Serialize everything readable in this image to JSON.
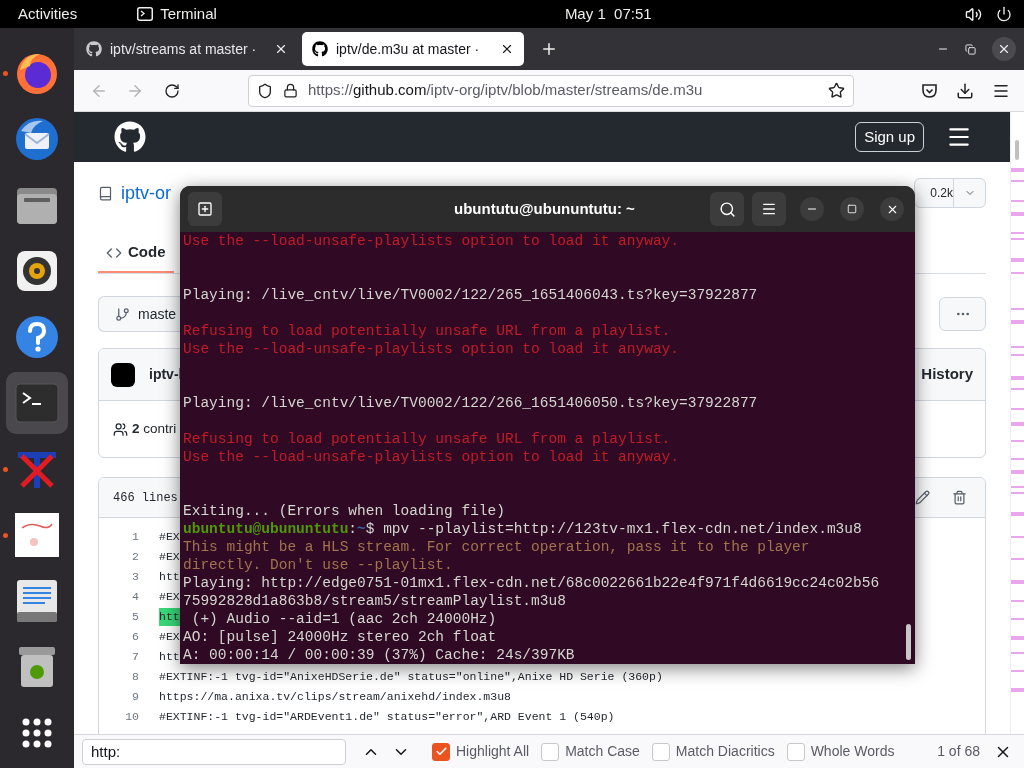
{
  "top_bar": {
    "activities": "Activities",
    "app": "Terminal",
    "clock": "May 1  07:51"
  },
  "dock": [
    {
      "kind": "firefox",
      "running": true,
      "selected": false
    },
    {
      "kind": "thunderbird",
      "running": false,
      "selected": false
    },
    {
      "kind": "files",
      "running": false,
      "selected": false
    },
    {
      "kind": "rhythmbox",
      "running": false,
      "selected": false
    },
    {
      "kind": "help",
      "running": false,
      "selected": false
    },
    {
      "kind": "terminal",
      "running": false,
      "selected": true
    },
    {
      "kind": "tex",
      "running": true,
      "selected": false
    },
    {
      "kind": "image",
      "running": true,
      "selected": false
    },
    {
      "kind": "editor",
      "running": false,
      "selected": false
    },
    {
      "kind": "trash",
      "running": false,
      "selected": false
    },
    {
      "kind": "apps",
      "running": false,
      "selected": false
    }
  ],
  "browser": {
    "tabs": [
      {
        "title": "iptv/streams at master ·",
        "selected": false
      },
      {
        "title": "iptv/de.m3u at master ·",
        "selected": true
      }
    ],
    "url": "https://**github.com**/iptv-org/iptv/blob/master/streams/de.m3u"
  },
  "github": {
    "sign_up": "Sign up",
    "repo": "iptv-or",
    "star_count": "0.2k",
    "tabs": [
      {
        "label": "Code",
        "selected": true
      }
    ],
    "branch": "maste",
    "commit_author": "iptv-l",
    "history": "History",
    "contributors_count": "2",
    "contributors_label": "contri",
    "lines": "466 lines",
    "code_lines": [
      {
        "number": "1",
        "text": "#EX",
        "current_match": false
      },
      {
        "number": "2",
        "text": "#EX",
        "current_match": false
      },
      {
        "number": "3",
        "text": "htt",
        "current_match": false
      },
      {
        "number": "4",
        "text": "#EX",
        "current_match": false
      },
      {
        "number": "5",
        "text": "htt",
        "current_match": true
      },
      {
        "number": "6",
        "text": "#EX",
        "current_match": false
      },
      {
        "number": "7",
        "text": "htt",
        "current_match": false
      },
      {
        "number": "8",
        "text": "#EXTINF:-1 tvg-id=\"AnixeHDSerie.de\" status=\"online\",Anixe HD Serie (360p)",
        "current_match": false
      },
      {
        "number": "9",
        "text": "https://ma.anixa.tv/clips/stream/anixehd/index.m3u8",
        "current_match": false
      },
      {
        "number": "10",
        "text": "#EXTINF:-1 tvg-id=\"ARDEvent1.de\" status=\"error\",ARD Event 1 (540p)",
        "current_match": false
      }
    ]
  },
  "terminal": {
    "title": "ubuntutu@ubununtutu: ~",
    "lines": [
      {
        "kind": "error",
        "text": "Use the --load-unsafe-playlists option to load it anyway."
      },
      {
        "kind": "blank"
      },
      {
        "kind": "blank"
      },
      {
        "kind": "output",
        "text": "Playing: /live_cntv/live/TV0002/122/265_1651406043.ts?key=37922877"
      },
      {
        "kind": "blank"
      },
      {
        "kind": "error",
        "text": "Refusing to load potentially unsafe URL from a playlist."
      },
      {
        "kind": "error",
        "text": "Use the --load-unsafe-playlists option to load it anyway."
      },
      {
        "kind": "blank"
      },
      {
        "kind": "blank"
      },
      {
        "kind": "output",
        "text": "Playing: /live_cntv/live/TV0002/122/266_1651406050.ts?key=37922877"
      },
      {
        "kind": "blank"
      },
      {
        "kind": "error",
        "text": "Refusing to load potentially unsafe URL from a playlist."
      },
      {
        "kind": "error",
        "text": "Use the --load-unsafe-playlists option to load it anyway."
      },
      {
        "kind": "blank"
      },
      {
        "kind": "blank"
      },
      {
        "kind": "output",
        "text": "Exiting... (Errors when loading file)"
      },
      {
        "kind": "prompt",
        "user": "ubuntutu@ubununtutu",
        "separator": ":",
        "path": "~",
        "text": "$ mpv --playlist=http://123tv-mx1.flex-cdn.net/index.m3u8"
      },
      {
        "kind": "warning",
        "text": "This might be a HLS stream. For correct operation, pass it to the player"
      },
      {
        "kind": "warning",
        "text": "directly. Don't use --playlist."
      },
      {
        "kind": "output",
        "text": "Playing: http://edge0751-01mx1.flex-cdn.net/68c0022661b22e4f971f4d6619cc24c02b56"
      },
      {
        "kind": "output",
        "text": "75992828d1a863b8/stream5/streamPlaylist.m3u8"
      },
      {
        "kind": "output",
        "text": " (+) Audio --aid=1 (aac 2ch 24000Hz)"
      },
      {
        "kind": "output",
        "text": "AO: [pulse] 24000Hz stereo 2ch float"
      },
      {
        "kind": "output",
        "text": "A: 00:00:14 / 00:00:39 (37%) Cache: 24s/397KB"
      }
    ]
  },
  "find_bar": {
    "value": "http:",
    "options": [
      {
        "label": "Highlight All",
        "checked": true
      },
      {
        "label": "Match Case",
        "checked": false
      },
      {
        "label": "Match Diacritics",
        "checked": false
      },
      {
        "label": "Whole Words",
        "checked": false
      }
    ],
    "count": "1 of 68"
  }
}
